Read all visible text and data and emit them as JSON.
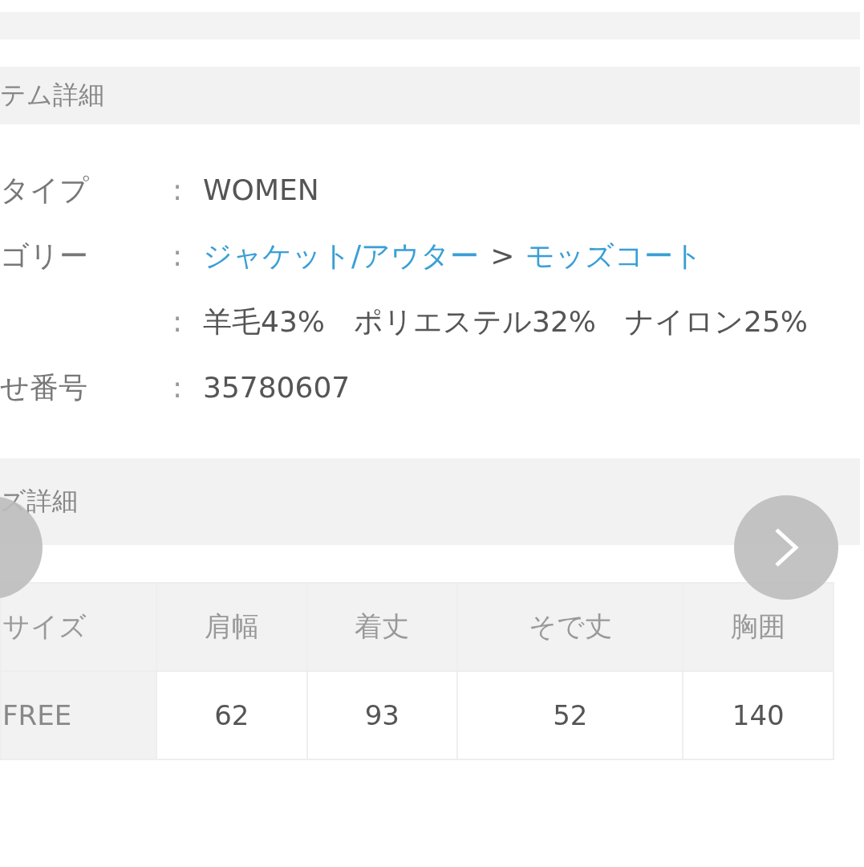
{
  "item_section": {
    "title": "テム詳細"
  },
  "details": [
    {
      "kind": "text",
      "label": "タイプ",
      "colon": ":",
      "value": "WOMEN"
    },
    {
      "kind": "links",
      "label": "ゴリー",
      "colon": ":",
      "links": [
        "ジャケット/アウター",
        "モッズコート"
      ],
      "separator": ">"
    },
    {
      "kind": "text",
      "colon": ":",
      "value": "羊毛43%　ポリエステル32%　ナイロン25%"
    },
    {
      "kind": "text",
      "label": "せ番号",
      "colon": ":",
      "value": "35780607"
    }
  ],
  "size_section": {
    "title": "ズ詳細"
  },
  "size_table": {
    "columns": [
      "サイズ",
      "肩幅",
      "着丈",
      "そで丈",
      "胸囲"
    ],
    "rows": [
      [
        "FREE",
        "62",
        "93",
        "52",
        "140"
      ]
    ]
  }
}
